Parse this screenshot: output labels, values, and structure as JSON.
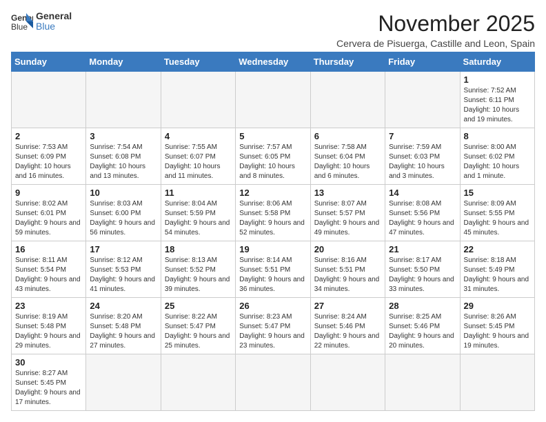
{
  "logo": {
    "line1": "General",
    "line2": "Blue"
  },
  "title": "November 2025",
  "subtitle": "Cervera de Pisuerga, Castille and Leon, Spain",
  "weekdays": [
    "Sunday",
    "Monday",
    "Tuesday",
    "Wednesday",
    "Thursday",
    "Friday",
    "Saturday"
  ],
  "weeks": [
    [
      {
        "day": "",
        "info": ""
      },
      {
        "day": "",
        "info": ""
      },
      {
        "day": "",
        "info": ""
      },
      {
        "day": "",
        "info": ""
      },
      {
        "day": "",
        "info": ""
      },
      {
        "day": "",
        "info": ""
      },
      {
        "day": "1",
        "info": "Sunrise: 7:52 AM\nSunset: 6:11 PM\nDaylight: 10 hours and 19 minutes."
      }
    ],
    [
      {
        "day": "2",
        "info": "Sunrise: 7:53 AM\nSunset: 6:09 PM\nDaylight: 10 hours and 16 minutes."
      },
      {
        "day": "3",
        "info": "Sunrise: 7:54 AM\nSunset: 6:08 PM\nDaylight: 10 hours and 13 minutes."
      },
      {
        "day": "4",
        "info": "Sunrise: 7:55 AM\nSunset: 6:07 PM\nDaylight: 10 hours and 11 minutes."
      },
      {
        "day": "5",
        "info": "Sunrise: 7:57 AM\nSunset: 6:05 PM\nDaylight: 10 hours and 8 minutes."
      },
      {
        "day": "6",
        "info": "Sunrise: 7:58 AM\nSunset: 6:04 PM\nDaylight: 10 hours and 6 minutes."
      },
      {
        "day": "7",
        "info": "Sunrise: 7:59 AM\nSunset: 6:03 PM\nDaylight: 10 hours and 3 minutes."
      },
      {
        "day": "8",
        "info": "Sunrise: 8:00 AM\nSunset: 6:02 PM\nDaylight: 10 hours and 1 minute."
      }
    ],
    [
      {
        "day": "9",
        "info": "Sunrise: 8:02 AM\nSunset: 6:01 PM\nDaylight: 9 hours and 59 minutes."
      },
      {
        "day": "10",
        "info": "Sunrise: 8:03 AM\nSunset: 6:00 PM\nDaylight: 9 hours and 56 minutes."
      },
      {
        "day": "11",
        "info": "Sunrise: 8:04 AM\nSunset: 5:59 PM\nDaylight: 9 hours and 54 minutes."
      },
      {
        "day": "12",
        "info": "Sunrise: 8:06 AM\nSunset: 5:58 PM\nDaylight: 9 hours and 52 minutes."
      },
      {
        "day": "13",
        "info": "Sunrise: 8:07 AM\nSunset: 5:57 PM\nDaylight: 9 hours and 49 minutes."
      },
      {
        "day": "14",
        "info": "Sunrise: 8:08 AM\nSunset: 5:56 PM\nDaylight: 9 hours and 47 minutes."
      },
      {
        "day": "15",
        "info": "Sunrise: 8:09 AM\nSunset: 5:55 PM\nDaylight: 9 hours and 45 minutes."
      }
    ],
    [
      {
        "day": "16",
        "info": "Sunrise: 8:11 AM\nSunset: 5:54 PM\nDaylight: 9 hours and 43 minutes."
      },
      {
        "day": "17",
        "info": "Sunrise: 8:12 AM\nSunset: 5:53 PM\nDaylight: 9 hours and 41 minutes."
      },
      {
        "day": "18",
        "info": "Sunrise: 8:13 AM\nSunset: 5:52 PM\nDaylight: 9 hours and 39 minutes."
      },
      {
        "day": "19",
        "info": "Sunrise: 8:14 AM\nSunset: 5:51 PM\nDaylight: 9 hours and 36 minutes."
      },
      {
        "day": "20",
        "info": "Sunrise: 8:16 AM\nSunset: 5:51 PM\nDaylight: 9 hours and 34 minutes."
      },
      {
        "day": "21",
        "info": "Sunrise: 8:17 AM\nSunset: 5:50 PM\nDaylight: 9 hours and 33 minutes."
      },
      {
        "day": "22",
        "info": "Sunrise: 8:18 AM\nSunset: 5:49 PM\nDaylight: 9 hours and 31 minutes."
      }
    ],
    [
      {
        "day": "23",
        "info": "Sunrise: 8:19 AM\nSunset: 5:48 PM\nDaylight: 9 hours and 29 minutes."
      },
      {
        "day": "24",
        "info": "Sunrise: 8:20 AM\nSunset: 5:48 PM\nDaylight: 9 hours and 27 minutes."
      },
      {
        "day": "25",
        "info": "Sunrise: 8:22 AM\nSunset: 5:47 PM\nDaylight: 9 hours and 25 minutes."
      },
      {
        "day": "26",
        "info": "Sunrise: 8:23 AM\nSunset: 5:47 PM\nDaylight: 9 hours and 23 minutes."
      },
      {
        "day": "27",
        "info": "Sunrise: 8:24 AM\nSunset: 5:46 PM\nDaylight: 9 hours and 22 minutes."
      },
      {
        "day": "28",
        "info": "Sunrise: 8:25 AM\nSunset: 5:46 PM\nDaylight: 9 hours and 20 minutes."
      },
      {
        "day": "29",
        "info": "Sunrise: 8:26 AM\nSunset: 5:45 PM\nDaylight: 9 hours and 19 minutes."
      }
    ],
    [
      {
        "day": "30",
        "info": "Sunrise: 8:27 AM\nSunset: 5:45 PM\nDaylight: 9 hours and 17 minutes."
      },
      {
        "day": "",
        "info": ""
      },
      {
        "day": "",
        "info": ""
      },
      {
        "day": "",
        "info": ""
      },
      {
        "day": "",
        "info": ""
      },
      {
        "day": "",
        "info": ""
      },
      {
        "day": "",
        "info": ""
      }
    ]
  ]
}
